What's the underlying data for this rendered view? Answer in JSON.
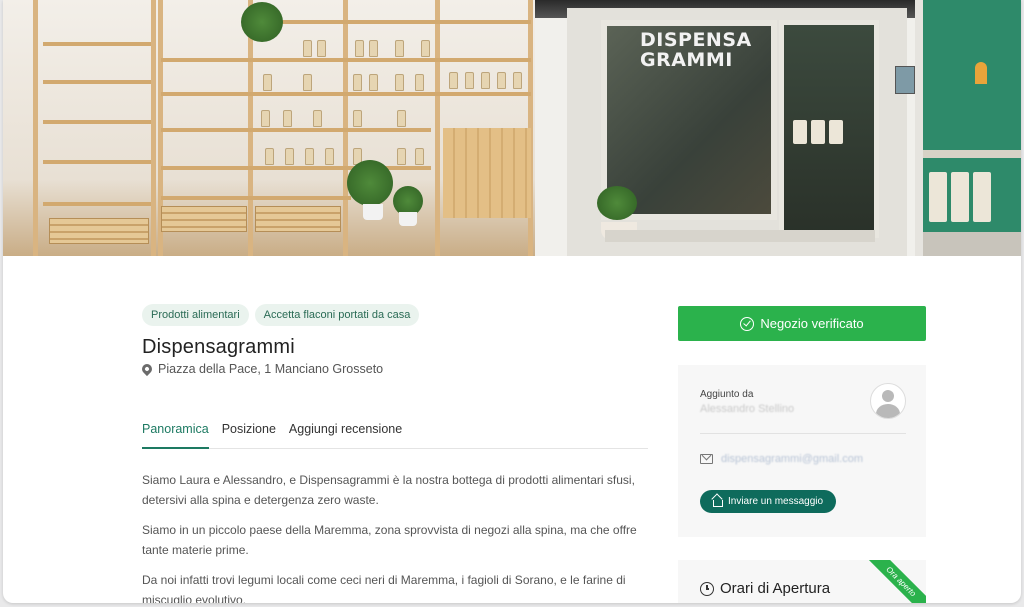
{
  "gallery": {
    "storefront_sign": [
      "DISPENSA",
      "GRAMMI"
    ]
  },
  "listing": {
    "tags": [
      "Prodotti alimentari",
      "Accetta flaconi portati da casa"
    ],
    "title": "Dispensagrammi",
    "address": "Piazza della Pace, 1 Manciano Grosseto",
    "tabs": [
      "Panoramica",
      "Posizione",
      "Aggiungi recensione"
    ],
    "description": [
      "Siamo Laura e Alessandro, e Dispensagrammi è la nostra bottega di prodotti alimentari sfusi, detersivi alla spina e detergenza zero waste.",
      "Siamo in un piccolo paese della Maremma, zona sprovvista di negozi alla spina, ma che offre tante materie prime.",
      "Da noi infatti trovi legumi locali come ceci neri di Maremma,  i fagioli di Sorano, e le farine di miscuglio evolutivo."
    ]
  },
  "sidebar": {
    "verified_label": "Negozio verificato",
    "added_by_label": "Aggiunto da",
    "owner_name": "Alessandro Stellino",
    "email": "dispensagrammi@gmail.com",
    "message_button": "Inviare un messaggio",
    "hours_title": "Orari di Apertura",
    "open_badge": "Ora aperto"
  },
  "colors": {
    "accent_green": "#2bb24c",
    "dark_teal": "#0e6b5c",
    "tab_active": "#1d7a62"
  }
}
